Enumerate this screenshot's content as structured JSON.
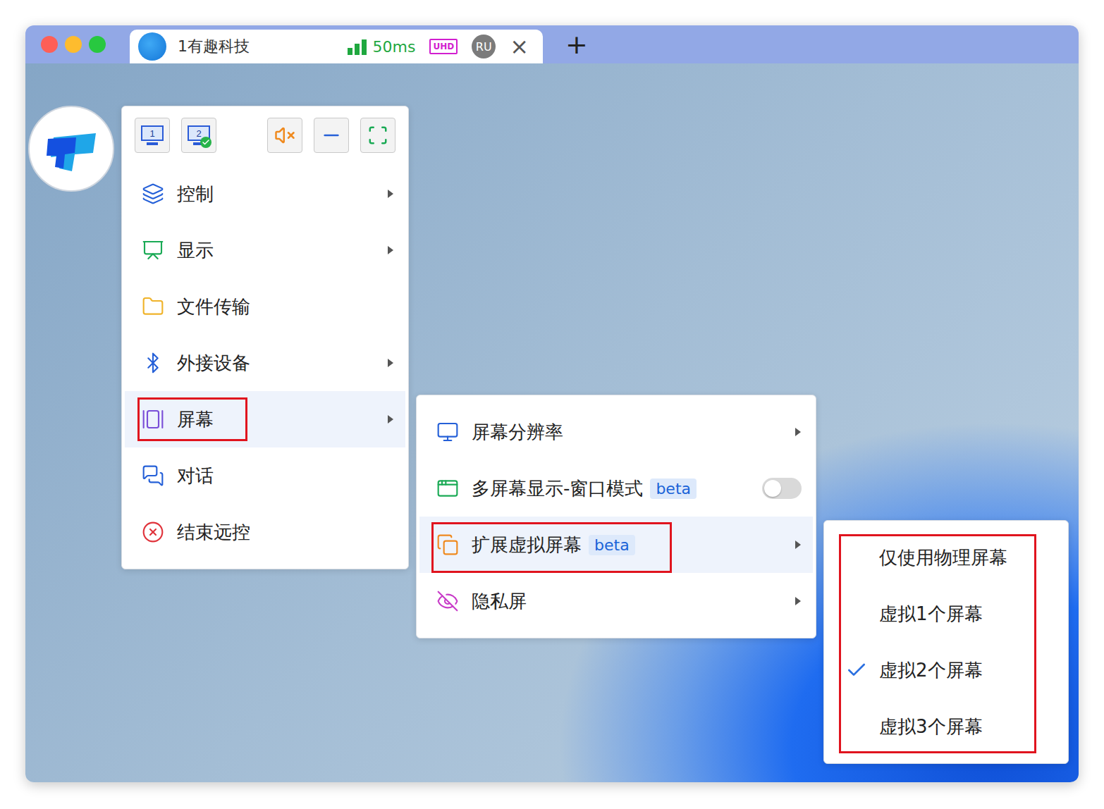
{
  "window": {
    "tabs": [
      {
        "title": "1有趣科技",
        "selected": true,
        "latency": "50ms",
        "signal_level": 1,
        "quality": "UHD",
        "user": "RU",
        "close": "×"
      }
    ],
    "new_tab": "+"
  },
  "toolbar": [
    {
      "kind": "screen",
      "label": "1",
      "selected": false
    },
    {
      "kind": "screen",
      "label": "2",
      "selected": true
    },
    {
      "kind": "mute",
      "muted": true
    },
    {
      "kind": "minimize"
    },
    {
      "kind": "fullscreen"
    }
  ],
  "menu": {
    "items": [
      {
        "label": "控制",
        "has_submenu": true,
        "highlighted": false,
        "annotated": false
      },
      {
        "label": "显示",
        "has_submenu": true,
        "highlighted": false,
        "annotated": false
      },
      {
        "label": "文件传输",
        "has_submenu": false,
        "highlighted": false,
        "annotated": false
      },
      {
        "label": "外接设备",
        "has_submenu": true,
        "highlighted": false,
        "annotated": false
      },
      {
        "label": "屏幕",
        "has_submenu": true,
        "highlighted": true,
        "annotated": true
      },
      {
        "label": "对话",
        "has_submenu": false,
        "highlighted": false,
        "annotated": false
      },
      {
        "label": "结束远控",
        "has_submenu": false,
        "highlighted": false,
        "annotated": false
      }
    ]
  },
  "screen_submenu": {
    "items": [
      {
        "label": "屏幕分辨率",
        "badge": "",
        "kind": "submenu",
        "on": false,
        "highlighted": false,
        "annotated": false
      },
      {
        "label": "多屏幕显示-窗口模式",
        "badge": "beta",
        "kind": "toggle",
        "on": false,
        "highlighted": false,
        "annotated": false
      },
      {
        "label": "扩展虚拟屏幕",
        "badge": "beta",
        "kind": "submenu",
        "on": false,
        "highlighted": true,
        "annotated": true
      },
      {
        "label": "隐私屏",
        "badge": "",
        "kind": "submenu",
        "on": false,
        "highlighted": false,
        "annotated": false
      }
    ]
  },
  "virtual_screen_submenu": {
    "annotated": true,
    "options": [
      {
        "label": "仅使用物理屏幕",
        "selected": false
      },
      {
        "label": "虚拟1个屏幕",
        "selected": false
      },
      {
        "label": "虚拟2个屏幕",
        "selected": true
      },
      {
        "label": "虚拟3个屏幕",
        "selected": false
      }
    ]
  }
}
